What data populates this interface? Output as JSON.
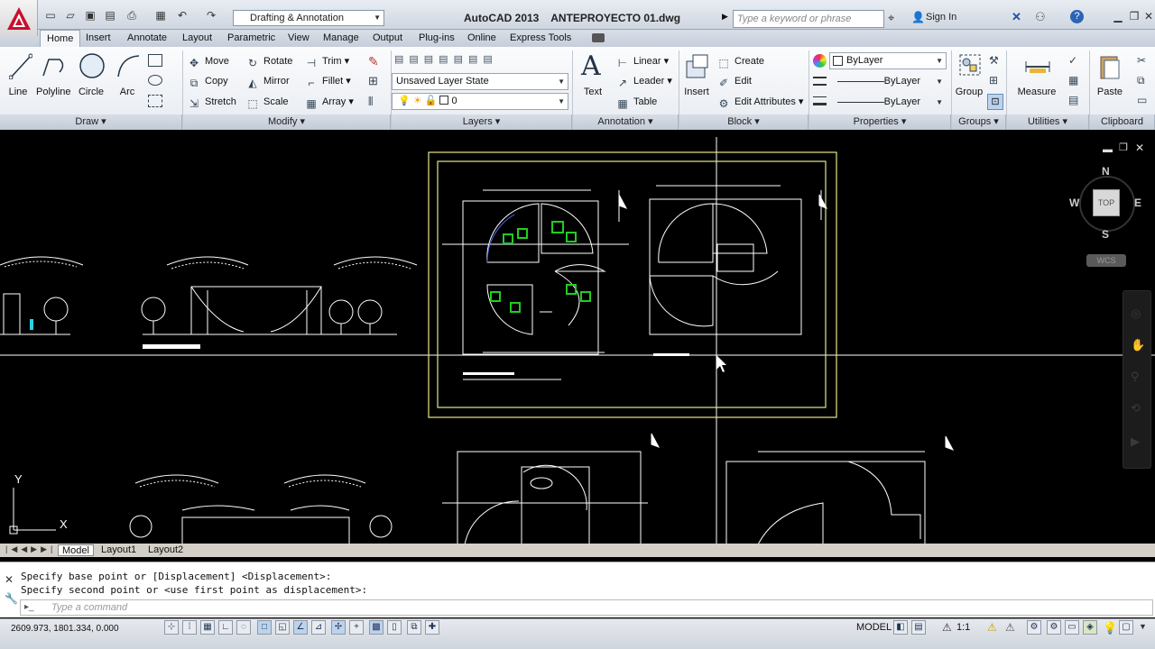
{
  "app": {
    "title": "AutoCAD 2013    ANTEPROYECTO 01.dwg",
    "workspace": "Drafting & Annotation",
    "search_placeholder": "Type a keyword or phrase",
    "sign_in": "Sign In"
  },
  "tabs": [
    "Home",
    "Insert",
    "Annotate",
    "Layout",
    "Parametric",
    "View",
    "Manage",
    "Output",
    "Plug-ins",
    "Online",
    "Express Tools"
  ],
  "ribbon": {
    "draw": {
      "line": "Line",
      "polyline": "Polyline",
      "circle": "Circle",
      "arc": "Arc",
      "panel": "Draw"
    },
    "modify": {
      "move": "Move",
      "rotate": "Rotate",
      "trim": "Trim",
      "copy": "Copy",
      "mirror": "Mirror",
      "fillet": "Fillet",
      "stretch": "Stretch",
      "scale": "Scale",
      "array": "Array",
      "panel": "Modify"
    },
    "layers": {
      "state": "Unsaved Layer State",
      "layer": "0",
      "panel": "Layers"
    },
    "annotation": {
      "text": "Text",
      "linear": "Linear",
      "leader": "Leader",
      "table": "Table",
      "panel": "Annotation"
    },
    "block": {
      "insert": "Insert",
      "create": "Create",
      "edit": "Edit",
      "edit_attributes": "Edit Attributes",
      "panel": "Block"
    },
    "properties": {
      "color": "ByLayer",
      "linetype": "ByLayer",
      "lineweight": "ByLayer",
      "panel": "Properties"
    },
    "groups": {
      "group": "Group",
      "panel": "Groups"
    },
    "utilities": {
      "measure": "Measure",
      "panel": "Utilities"
    },
    "clipboard": {
      "paste": "Paste",
      "panel": "Clipboard"
    }
  },
  "viewcube": {
    "n": "N",
    "s": "S",
    "e": "E",
    "w": "W",
    "top": "TOP",
    "wcs": "WCS"
  },
  "ucs": {
    "y": "Y",
    "x": "X"
  },
  "layout_tabs": [
    "Model",
    "Layout1",
    "Layout2"
  ],
  "command": {
    "line1": "Specify base point or [Displacement] <Displacement>:",
    "line2": "Specify second point or <use first point as displacement>:",
    "placeholder": "Type a command"
  },
  "status": {
    "coords": "2609.973, 1801.334, 0.000",
    "model": "MODEL",
    "scale": "1:1"
  },
  "colors": {
    "canvas": "#000000",
    "viewport_frame": "#e6e68c",
    "hatch": "#22cc22",
    "ribbon": "#eef1f5"
  }
}
